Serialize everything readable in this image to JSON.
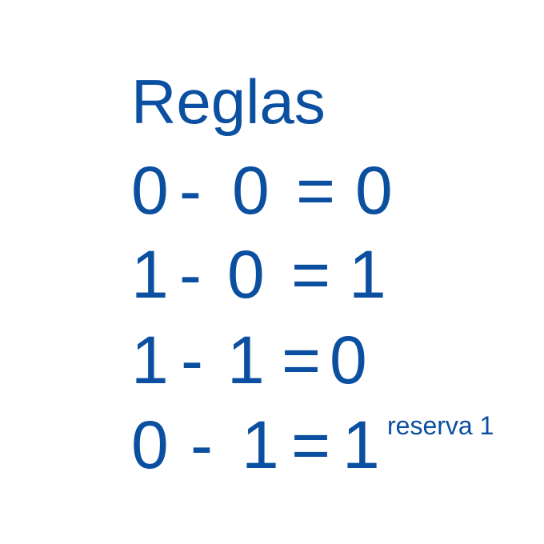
{
  "title": "Reglas",
  "rules": [
    {
      "a": "0",
      "operator": "-",
      "b": "0",
      "equals": "=",
      "result": "0",
      "note": ""
    },
    {
      "a": "1",
      "operator": "-",
      "b": "0",
      "equals": "=",
      "result": "1",
      "note": ""
    },
    {
      "a": "1",
      "operator": "-",
      "b": "1",
      "equals": "=",
      "result": "0",
      "note": ""
    },
    {
      "a": "0",
      "operator": "-",
      "b": "1",
      "equals": "=",
      "result": "1",
      "note": "reserva 1"
    }
  ],
  "colors": {
    "text": "#0b4fa0",
    "background": "#ffffff"
  }
}
